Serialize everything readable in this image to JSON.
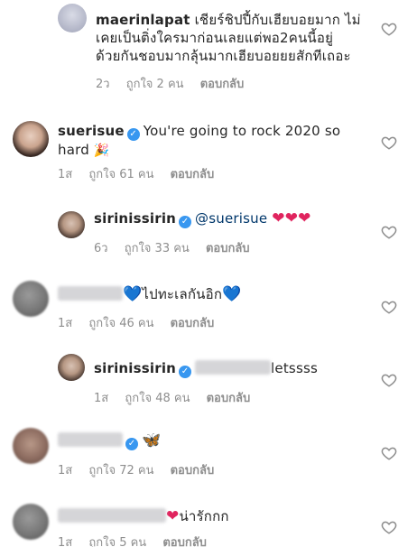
{
  "comments": [
    {
      "username": "maerinlapat",
      "line1": "เชียร์ชิปปี้กับเฮียบอยมาก ไม่",
      "line2": "เคยเป็นติ่งใครมาก่อนเลยแต่พอ2คนนี้อยู่",
      "line3": "ด้วยกันชอบมากลุ้นมากเฮียบอยยยสักทีเถอะ",
      "time": "2ว",
      "likes": "ถูกใจ 2 คน",
      "reply": "ตอบกลับ"
    },
    {
      "username": "suerisue",
      "text1": "You're going to rock 2020 so",
      "text2": "hard",
      "time": "1ส",
      "likes": "ถูกใจ 61 คน",
      "reply": "ตอบกลับ"
    },
    {
      "username": "sirinissirin",
      "mention": "@suerisue",
      "time": "6ว",
      "likes": "ถูกใจ 33 คน",
      "reply": "ตอบกลับ"
    },
    {
      "text": "ไปทะเลกันอิก",
      "time": "1ส",
      "likes": "ถูกใจ 46 คน",
      "reply": "ตอบกลับ"
    },
    {
      "username": "sirinissirin",
      "text": "letssss",
      "time": "1ส",
      "likes": "ถูกใจ 48 คน",
      "reply": "ตอบกลับ"
    },
    {
      "time": "1ส",
      "likes": "ถูกใจ 72 คน",
      "reply": "ตอบกลับ"
    },
    {
      "text": "น่ารักกก",
      "time": "1ส",
      "likes": "ถูกใจ 5 คน",
      "reply": "ตอบกลับ"
    }
  ],
  "colors": {
    "verified": "#3897f0",
    "meta": "#8e8e8e",
    "mention": "#00376b",
    "red_heart": "#e0245e",
    "blue_heart": "#2d8cf0"
  }
}
